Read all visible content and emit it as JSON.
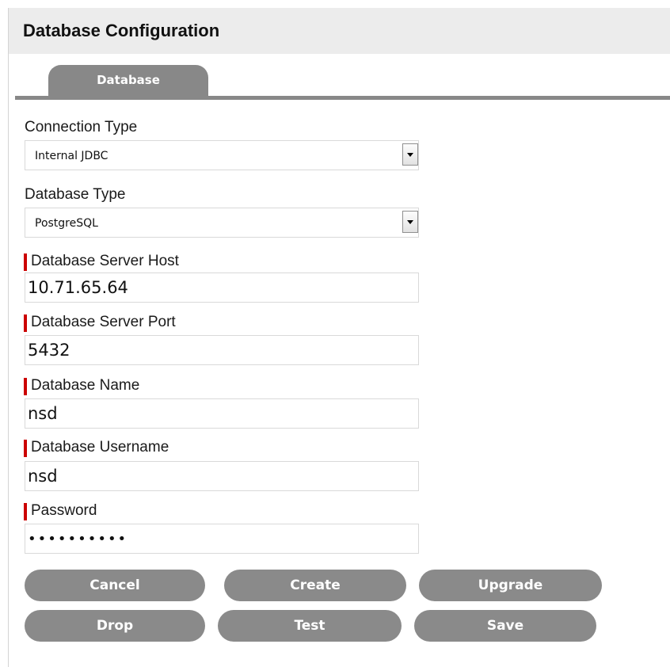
{
  "header": {
    "title": "Database Configuration"
  },
  "tabs": [
    {
      "label": "Database",
      "active": true
    }
  ],
  "form": {
    "connection_type": {
      "label": "Connection Type",
      "value": "Internal JDBC"
    },
    "database_type": {
      "label": "Database Type",
      "value": "PostgreSQL"
    },
    "server_host": {
      "label": "Database Server Host",
      "value": "10.71.65.64",
      "required": true
    },
    "server_port": {
      "label": "Database Server Port",
      "value": "5432",
      "required": true
    },
    "database_name": {
      "label": "Database Name",
      "value": "nsd",
      "required": true
    },
    "username": {
      "label": "Database Username",
      "value": "nsd",
      "required": true
    },
    "password": {
      "label": "Password",
      "value": "••••••••••",
      "required": true
    }
  },
  "buttons": {
    "cancel": "Cancel",
    "create": "Create",
    "upgrade": "Upgrade",
    "drop": "Drop",
    "test": "Test",
    "save": "Save"
  },
  "colors": {
    "header_bg": "#ececec",
    "tab_bg": "#888888",
    "button_bg": "#8a8a8a",
    "required_marker": "#cc0000"
  },
  "icons": {
    "dropdown": "chevron-down-icon",
    "required": "required-marker"
  }
}
